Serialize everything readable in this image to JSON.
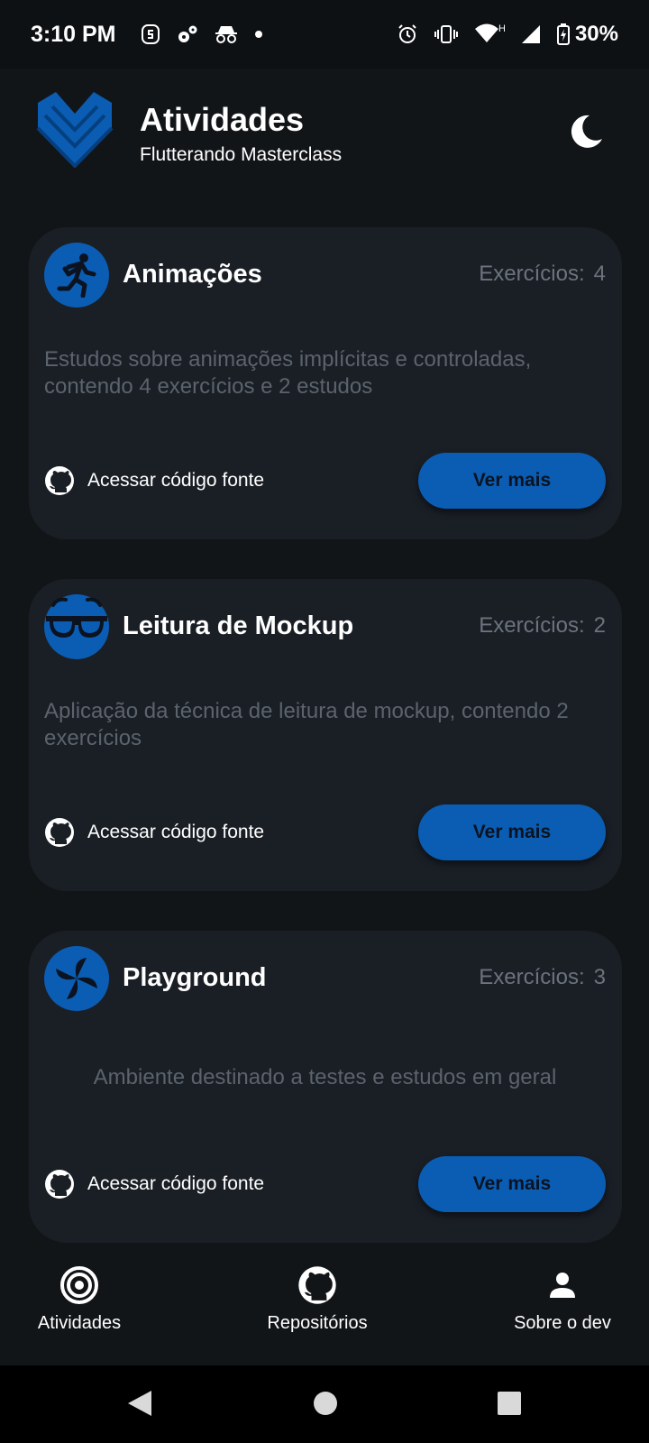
{
  "status_bar": {
    "time": "3:10 PM",
    "left_icons": [
      "s-notification-icon",
      "settings-gears-icon",
      "incognito-icon",
      "dot-icon"
    ],
    "right_icons": [
      "alarm-icon",
      "vibrate-icon",
      "wifi-icon",
      "cell-signal-icon",
      "battery-charging-icon"
    ],
    "network_label": "H",
    "battery": "30%"
  },
  "header": {
    "title": "Atividades",
    "subtitle": "Flutterando Masterclass",
    "theme_toggle_icon": "moon-icon"
  },
  "cards": [
    {
      "title": "Animações",
      "count_label": "Exercícios:",
      "count_value": "4",
      "description": "Estudos sobre animações implícitas e controladas, contendo 4 exercícios e 2 estudos",
      "link_label": "Acessar código fonte",
      "button_label": "Ver mais",
      "icon": "running-person-icon"
    },
    {
      "title": "Leitura de Mockup",
      "count_label": "Exercícios:",
      "count_value": "2",
      "description": "Aplicação da técnica de leitura de mockup, contendo 2 exercícios",
      "link_label": "Acessar código fonte",
      "button_label": "Ver mais",
      "icon": "glasses-icon"
    },
    {
      "title": "Playground",
      "count_label": "Exercícios:",
      "count_value": "3",
      "description": "Ambiente destinado a testes e estudos em geral",
      "link_label": "Acessar código fonte",
      "button_label": "Ver mais",
      "icon": "pinwheel-icon"
    }
  ],
  "bottom_nav": {
    "items": [
      {
        "label": "Atividades",
        "icon": "target-icon"
      },
      {
        "label": "Repositórios",
        "icon": "github-icon"
      },
      {
        "label": "Sobre o dev",
        "icon": "person-icon"
      }
    ]
  },
  "colors": {
    "background": "#121518",
    "card": "#1a1f26",
    "accent": "#0a5db3",
    "muted_text": "#5b636c"
  }
}
